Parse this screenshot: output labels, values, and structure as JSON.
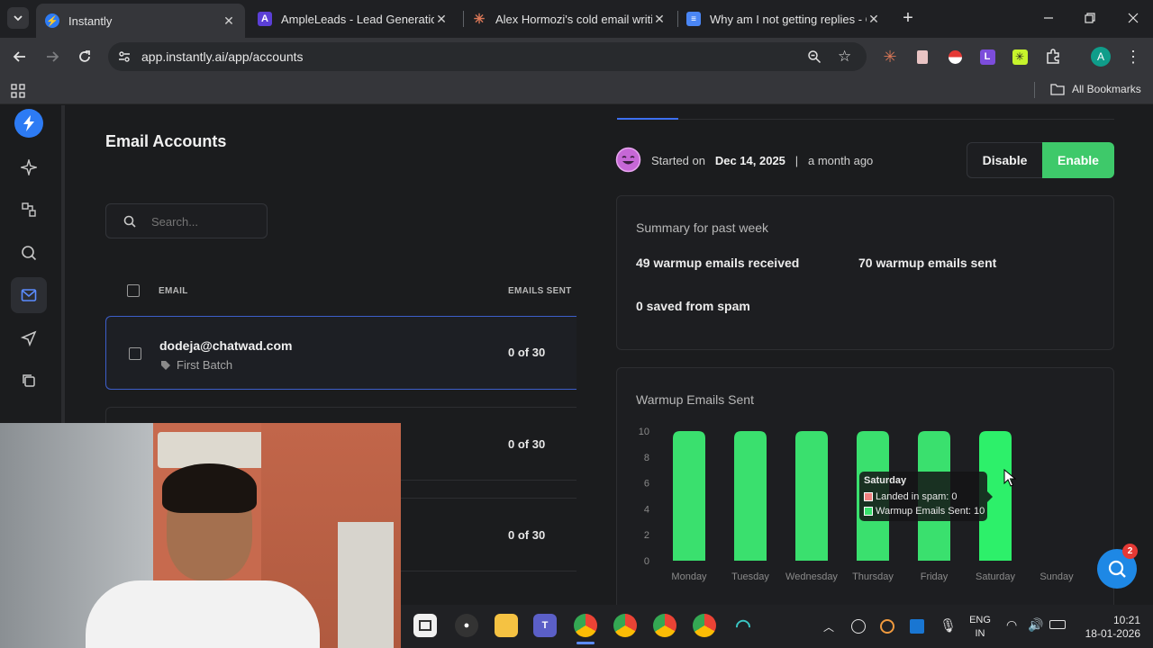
{
  "browser": {
    "tabs": [
      {
        "title": "Instantly",
        "active": true
      },
      {
        "title": "AmpleLeads - Lead Generation",
        "active": false
      },
      {
        "title": "Alex Hormozi's cold email writi",
        "active": false
      },
      {
        "title": "Why am I not getting replies - C",
        "active": false
      }
    ],
    "url": "app.instantly.ai/app/accounts",
    "bookmarks_label": "All Bookmarks",
    "profile_initial": "A"
  },
  "accounts": {
    "title": "Email Accounts",
    "search_placeholder": "Search...",
    "col_email": "EMAIL",
    "col_emails_sent": "EMAILS SENT",
    "rows": [
      {
        "email": "dodeja@chatwad.com",
        "tag": "First Batch",
        "sent": "0 of 30"
      },
      {
        "email": "",
        "tag": "",
        "sent": "0 of 30"
      },
      {
        "email": "",
        "tag": "",
        "sent": "0 of 30"
      }
    ]
  },
  "warmup": {
    "started_label": "Started on",
    "started_date": "Dec 14, 2025",
    "separator": "|",
    "started_relative": "a month ago",
    "disable_label": "Disable",
    "enable_label": "Enable",
    "summary_title": "Summary for past week",
    "received": "49 warmup emails received",
    "sent": "70 warmup emails sent",
    "saved": "0 saved from spam",
    "chart_title": "Warmup Emails Sent"
  },
  "tooltip": {
    "title": "Saturday",
    "spam_line": "Landed in spam: 0",
    "sent_line": "Warmup Emails Sent: 10"
  },
  "chat_badge": "2",
  "taskbar": {
    "lang_line1": "ENG",
    "lang_line2": "IN",
    "time": "10:21",
    "date": "18-01-2026"
  },
  "colors": {
    "accent_blue": "#5b8cff",
    "enable_green": "#3ec96a",
    "bar_green": "#3ae06e",
    "spam_red": "#f08080",
    "chat_blue": "#1e88e5"
  },
  "chart_data": {
    "type": "bar",
    "title": "Warmup Emails Sent",
    "categories": [
      "Monday",
      "Tuesday",
      "Wednesday",
      "Thursday",
      "Friday",
      "Saturday",
      "Sunday"
    ],
    "series": [
      {
        "name": "Warmup Emails Sent",
        "values": [
          10,
          10,
          10,
          10,
          10,
          10,
          0
        ]
      }
    ],
    "yticks": [
      "0",
      "2",
      "4",
      "6",
      "8",
      "10"
    ],
    "ylim": [
      0,
      10
    ],
    "grid": false
  }
}
